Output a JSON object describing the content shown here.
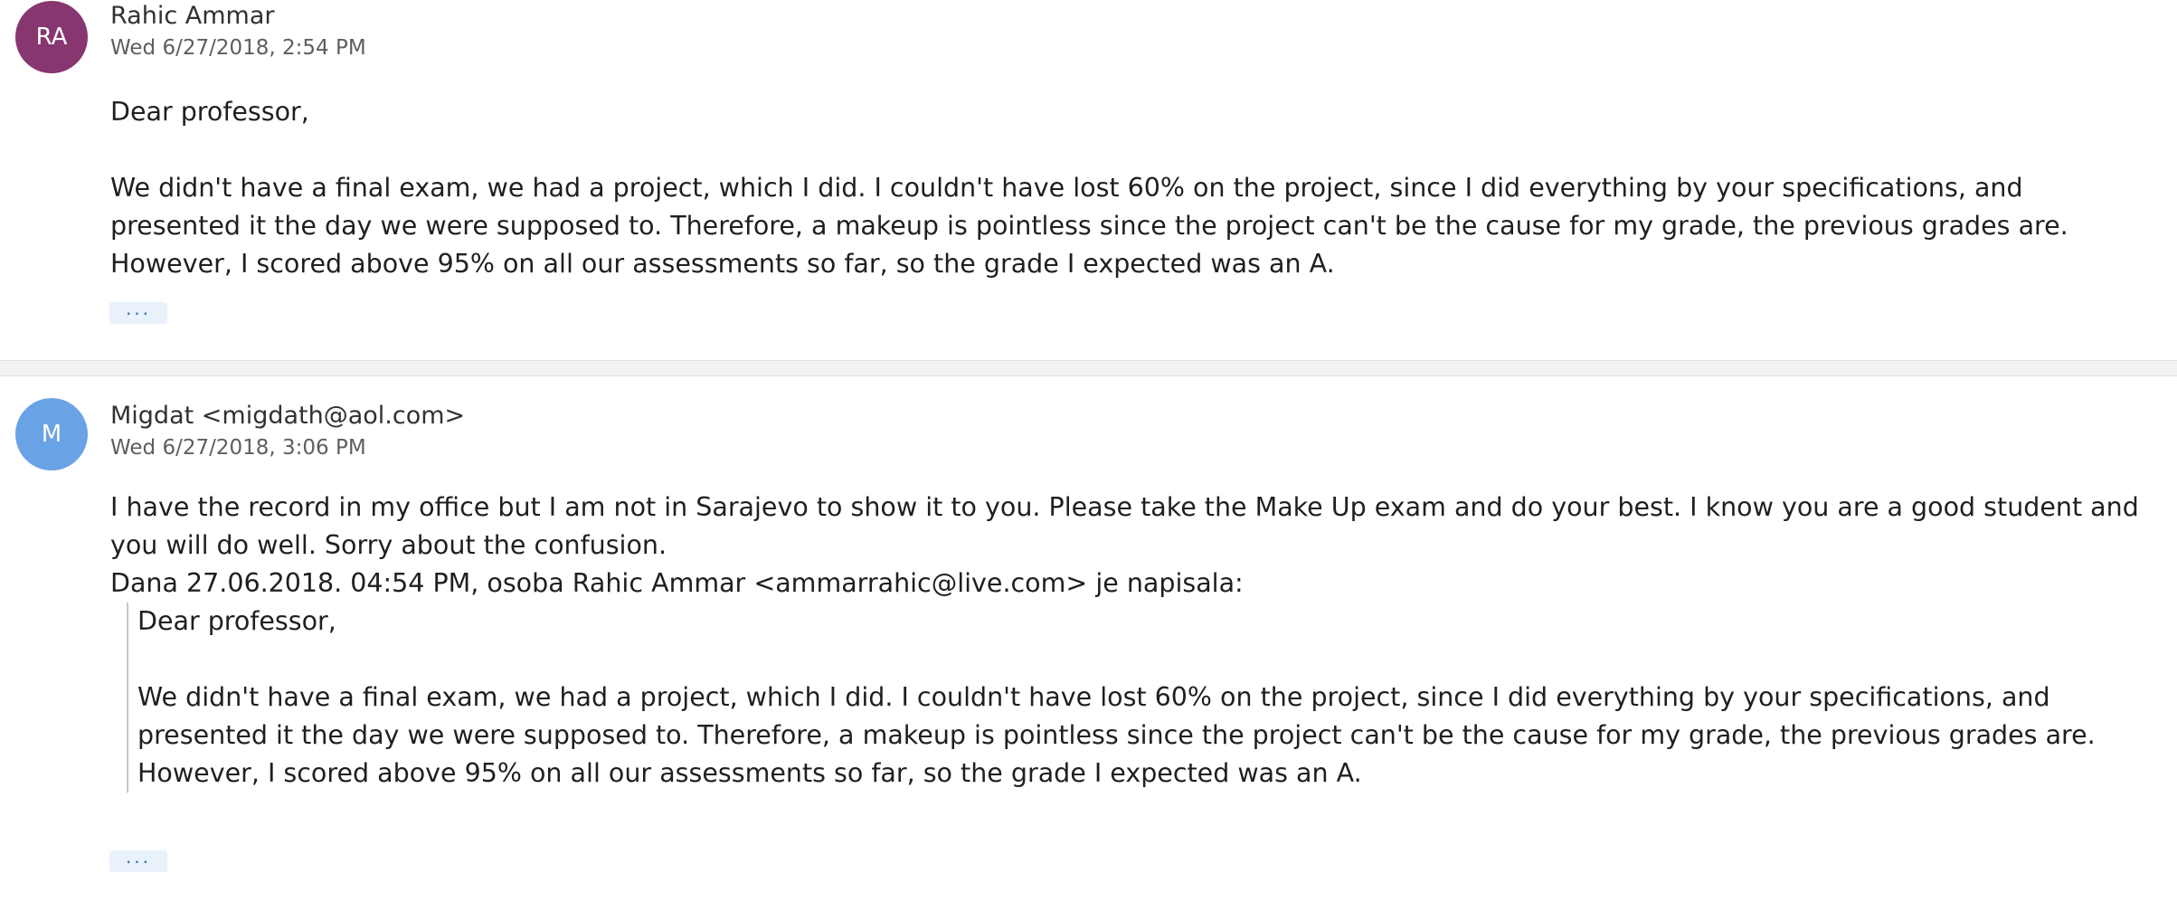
{
  "messages": [
    {
      "avatar_initials": "RA",
      "avatar_color": "#873670",
      "sender": "Rahic Ammar",
      "date": "Wed 6/27/2018, 2:54 PM",
      "greeting": "Dear professor,",
      "body": "We didn't have a final exam, we had a project, which I did. I couldn't have lost 60% on the project, since I did everything by your specifications, and presented it the day we were supposed to. Therefore, a makeup is pointless since the project can't be the cause for my grade, the previous grades are. However, I scored above 95% on all our assessments so far, so the grade I expected was an A.",
      "more_label": "..."
    },
    {
      "avatar_initials": "M",
      "avatar_color": "#6aa2e6",
      "sender": "Migdat <migdath@aol.com>",
      "date": "Wed 6/27/2018, 3:06 PM",
      "body": "I have the record in my office but I am not in Sarajevo to show it to you. Please take the Make Up exam and do your best. I know you are a good student and you will do well. Sorry about the confusion.",
      "quote_intro": "Dana 27.06.2018. 04:54 PM, osoba Rahic Ammar <ammarrahic@live.com> je napisala:",
      "quote_greeting": "Dear professor,",
      "quote_body": "We didn't have a final exam, we had a project, which I did. I couldn't have lost 60% on the project, since I did everything by your specifications, and presented it the day we were supposed to. Therefore, a makeup is pointless since the project can't be the cause for my grade, the previous grades are. However, I scored above 95% on all our assessments so far, so the grade I expected was an A.",
      "more_label": "..."
    }
  ]
}
